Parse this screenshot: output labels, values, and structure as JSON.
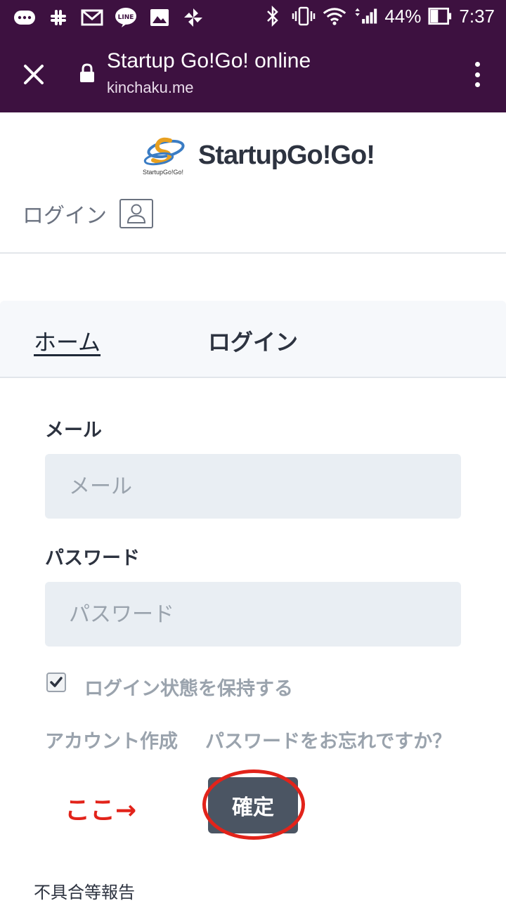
{
  "status_bar": {
    "battery": "44%",
    "time": "7:37",
    "left_icons": [
      "message-icon",
      "slack-icon",
      "gmail-icon",
      "line-icon",
      "image-icon",
      "pinwheel-icon"
    ],
    "right_icons": [
      "bluetooth-icon",
      "vibrate-icon",
      "wifi-icon",
      "signal-icon",
      "battery-icon"
    ]
  },
  "browser": {
    "title": "Startup Go!Go! online",
    "url": "kinchaku.me"
  },
  "site": {
    "logo_text": "StartupGo!Go!",
    "logo_mark_text": "StartupGo!Go!",
    "header_login": "ログイン"
  },
  "breadcrumb": {
    "home": "ホーム",
    "current": "ログイン"
  },
  "form": {
    "email_label": "メール",
    "email_placeholder": "メール",
    "email_value": "",
    "password_label": "パスワード",
    "password_placeholder": "パスワード",
    "password_value": "",
    "remember_label": "ログイン状態を保持する",
    "remember_checked": true,
    "create_account": "アカウント作成",
    "forgot_password": "パスワードをお忘れですか？",
    "submit": "確定"
  },
  "annotation": {
    "text": "ここ→",
    "color": "#e2231a"
  },
  "footer": {
    "report": "不具合等報告"
  },
  "colors": {
    "browser_bar": "#3d1140",
    "button": "#4b5563",
    "input_bg": "#e9eef3"
  }
}
